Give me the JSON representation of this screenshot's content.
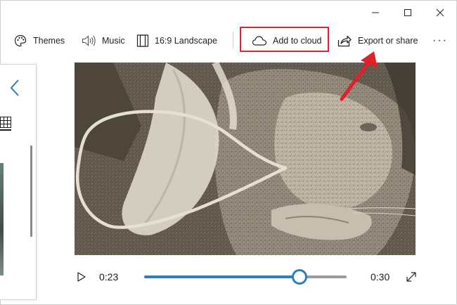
{
  "window": {
    "controls": [
      "minimize-icon",
      "maximize-icon",
      "close-icon"
    ]
  },
  "toolbar": {
    "themes_label": "Themes",
    "music_label": "Music",
    "aspect_label": "16:9 Landscape",
    "cloud_label": "Add to cloud",
    "export_label": "Export or share",
    "more_label": "···",
    "icons": [
      "palette-icon",
      "speaker-icon",
      "aspect-ratio-icon",
      "cloud-icon",
      "share-icon",
      "more-icon"
    ]
  },
  "annotation": {
    "highlight_color": "#e0202a",
    "arrow_color": "#e0202a"
  },
  "playback": {
    "current_time": "0:23",
    "total_time": "0:30",
    "progress": 0.767,
    "accent_color": "#2f7fb5"
  }
}
